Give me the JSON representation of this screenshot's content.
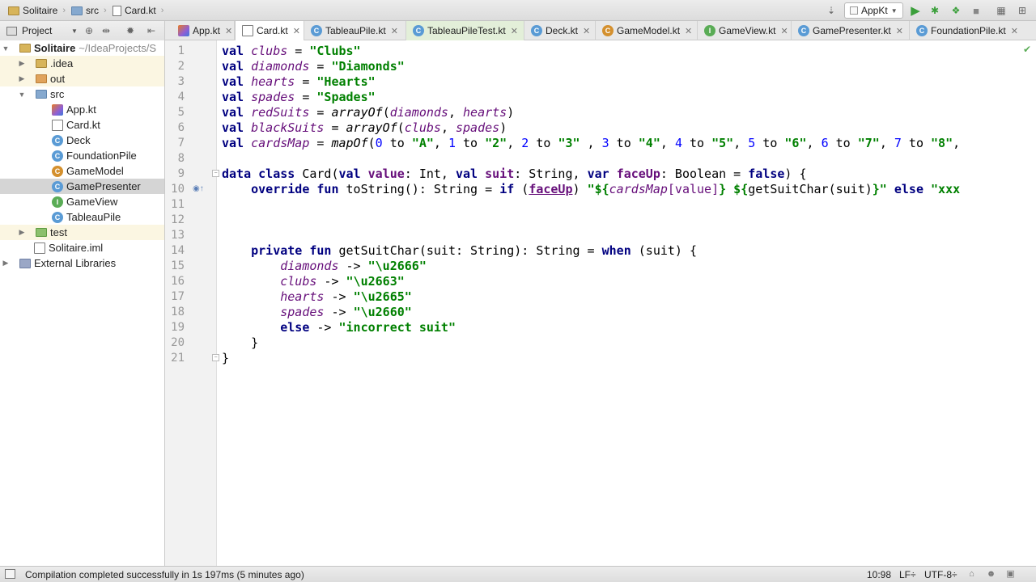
{
  "breadcrumbs": [
    {
      "label": "Solitaire",
      "icon": "project-folder-icon"
    },
    {
      "label": "src",
      "icon": "source-folder-icon"
    },
    {
      "label": "Card.kt",
      "icon": "file-icon"
    }
  ],
  "run_config": {
    "label": "AppKt"
  },
  "project_panel": {
    "selector_label": "Project"
  },
  "tabs": [
    {
      "label": "App.kt",
      "icon": "kotlin-file-icon"
    },
    {
      "label": "Card.kt",
      "icon": "file-icon",
      "active": true
    },
    {
      "label": "TableauPile.kt",
      "icon": "class-icon"
    },
    {
      "label": "TableauPileTest.kt",
      "icon": "class-icon"
    },
    {
      "label": "Deck.kt",
      "icon": "class-icon"
    },
    {
      "label": "GameModel.kt",
      "icon": "object-class-icon"
    },
    {
      "label": "GameView.kt",
      "icon": "interface-icon"
    },
    {
      "label": "GamePresenter.kt",
      "icon": "class-icon"
    },
    {
      "label": "FoundationPile.kt",
      "icon": "class-icon"
    }
  ],
  "tree": [
    {
      "label": "Solitaire",
      "path": "~/IdeaProjects/S",
      "icon": "project-folder-icon",
      "expanded": true
    },
    {
      "label": ".idea",
      "icon": "folder-icon",
      "expanded": false
    },
    {
      "label": "out",
      "icon": "excluded-folder-icon",
      "expanded": false
    },
    {
      "label": "src",
      "icon": "source-folder-icon",
      "expanded": true
    },
    {
      "label": "App.kt",
      "icon": "kotlin-file-icon"
    },
    {
      "label": "Card.kt",
      "icon": "file-icon"
    },
    {
      "label": "Deck",
      "icon": "class-icon"
    },
    {
      "label": "FoundationPile",
      "icon": "class-icon"
    },
    {
      "label": "GameModel",
      "icon": "object-class-icon"
    },
    {
      "label": "GamePresenter",
      "icon": "class-icon",
      "selected": true
    },
    {
      "label": "GameView",
      "icon": "interface-icon"
    },
    {
      "label": "TableauPile",
      "icon": "class-icon"
    },
    {
      "label": "test",
      "icon": "test-folder-icon",
      "expanded": false
    },
    {
      "label": "Solitaire.iml",
      "icon": "module-file-icon"
    },
    {
      "label": "External Libraries",
      "icon": "library-icon",
      "expanded": false
    }
  ],
  "editor": {
    "line_numbers": [
      "1",
      "2",
      "3",
      "4",
      "5",
      "6",
      "7",
      "8",
      "9",
      "10",
      "11",
      "12",
      "13",
      "14",
      "15",
      "16",
      "17",
      "18",
      "19",
      "20",
      "21"
    ]
  },
  "code": {
    "l1": {
      "kw": "val",
      "id": "clubs",
      "eq": " = ",
      "str": "\"Clubs\""
    },
    "l2": {
      "kw": "val",
      "id": "diamonds",
      "eq": " = ",
      "str": "\"Diamonds\""
    },
    "l3": {
      "kw": "val",
      "id": "hearts",
      "eq": " = ",
      "str": "\"Hearts\""
    },
    "l4": {
      "kw": "val",
      "id": "spades",
      "eq": " = ",
      "str": "\"Spades\""
    },
    "l5": {
      "kw": "val",
      "id": "redSuits",
      "eq": " = ",
      "fn": "arrayOf",
      "args": "(",
      "a1": "diamonds",
      "comma": ", ",
      "a2": "hearts",
      "close": ")"
    },
    "l6": {
      "kw": "val",
      "id": "blackSuits",
      "eq": " = ",
      "fn": "arrayOf",
      "args": "(",
      "a1": "clubs",
      "comma": ", ",
      "a2": "spades",
      "close": ")"
    },
    "l7": {
      "kw": "val",
      "id": "cardsMap",
      "eq": " = ",
      "fn": "mapOf",
      "open": "(",
      "pairs": [
        {
          "n": "0",
          "to": " to ",
          "s": "\"A\"",
          "sep": ", "
        },
        {
          "n": "1",
          "to": " to ",
          "s": "\"2\"",
          "sep": ", "
        },
        {
          "n": "2",
          "to": " to ",
          "s": "\"3\"",
          "sep": " , "
        },
        {
          "n": "3",
          "to": " to ",
          "s": "\"4\"",
          "sep": ", "
        },
        {
          "n": "4",
          "to": " to ",
          "s": "\"5\"",
          "sep": ", "
        },
        {
          "n": "5",
          "to": " to ",
          "s": "\"6\"",
          "sep": ", "
        },
        {
          "n": "6",
          "to": " to ",
          "s": "\"7\"",
          "sep": ", "
        },
        {
          "n": "7",
          "to": " to ",
          "s": "\"8\"",
          "sep": ","
        }
      ]
    },
    "l9": {
      "k1": "data class ",
      "name": "Card(",
      "k2": "val ",
      "p1": "value",
      "t1": ": Int, ",
      "k3": "val ",
      "p2": "suit",
      "t2": ": String, ",
      "k4": "var ",
      "p3": "faceUp",
      "t3": ": Boolean = ",
      "k5": "false",
      "end": ") {"
    },
    "l10": {
      "indent": "    ",
      "k1": "override fun ",
      "name": "toString(): String = ",
      "k2": "if ",
      "open": "(",
      "var": "faceUp",
      "close": ") ",
      "s1": "\"${",
      "map": "cardsMap",
      "idx": "[value]",
      "s2": "} ${",
      "call": "getSuitChar(suit)",
      "s3": "}\"",
      "k3": " else ",
      "s4": "\"xxx"
    },
    "l14": {
      "indent": "    ",
      "k1": "private fun ",
      "name": "getSuitChar(suit: String): String = ",
      "k2": "when",
      "rest": " (suit) {"
    },
    "l15": {
      "indent": "        ",
      "id": "diamonds",
      "arrow": " -> ",
      "str": "\"\\u2666\""
    },
    "l16": {
      "indent": "        ",
      "id": "clubs",
      "arrow": " -> ",
      "str": "\"\\u2663\""
    },
    "l17": {
      "indent": "        ",
      "id": "hearts",
      "arrow": " -> ",
      "str": "\"\\u2665\""
    },
    "l18": {
      "indent": "        ",
      "id": "spades",
      "arrow": " -> ",
      "str": "\"\\u2660\""
    },
    "l19": {
      "indent": "        ",
      "kw": "else",
      "arrow": " -> ",
      "str": "\"incorrect suit\""
    },
    "l20": {
      "text": "    }"
    },
    "l21": {
      "text": "}"
    }
  },
  "status": {
    "message": "Compilation completed successfully in 1s 197ms (5 minutes ago)",
    "position": "10:98",
    "line_sep": "LF÷",
    "encoding": "UTF-8÷"
  },
  "colors": {
    "keyword": "#000080",
    "string": "#008000",
    "identifier": "#660e7a",
    "number": "#0000ff",
    "selection": "#d5d5d5"
  }
}
